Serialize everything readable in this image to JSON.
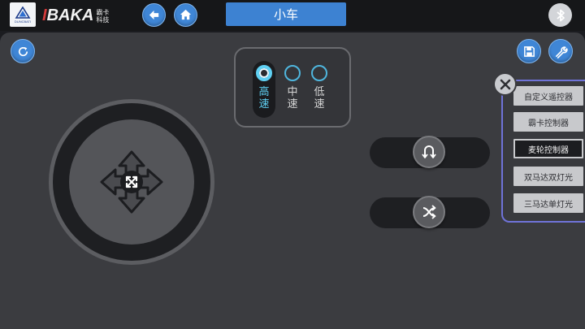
{
  "header": {
    "logo_text": "DUNCBATI",
    "brand_name_prefix": "I",
    "brand_name": "BAKA",
    "brand_sub_line1": "霸卡",
    "brand_sub_line2": "科技",
    "title": "小车"
  },
  "icons": {
    "back": "arrow-left-icon",
    "home": "home-icon",
    "bluetooth": "bluetooth-icon",
    "refresh": "refresh-icon",
    "save": "save-icon",
    "settings": "wrench-icon",
    "close": "close-icon",
    "joystick": "four-way-arrows-icon",
    "u_turn": "u-turn-icon",
    "shuffle": "crossing-arrows-icon"
  },
  "speed": {
    "options": [
      {
        "label": "高速",
        "selected": true
      },
      {
        "label": "中速",
        "selected": false
      },
      {
        "label": "低速",
        "selected": false
      }
    ]
  },
  "menu": {
    "items": [
      {
        "label": "自定义遥控器",
        "selected": false
      },
      {
        "label": "霸卡控制器",
        "selected": false
      },
      {
        "label": "麦轮控制器",
        "selected": true
      },
      {
        "label": "双马达双灯光",
        "selected": false
      },
      {
        "label": "三马达单灯光",
        "selected": false
      }
    ]
  },
  "colors": {
    "accent_blue": "#3d82d2",
    "speed_active": "#5fd0f3",
    "menu_border": "#6f73d8",
    "panel_bg": "#3b3c40"
  }
}
